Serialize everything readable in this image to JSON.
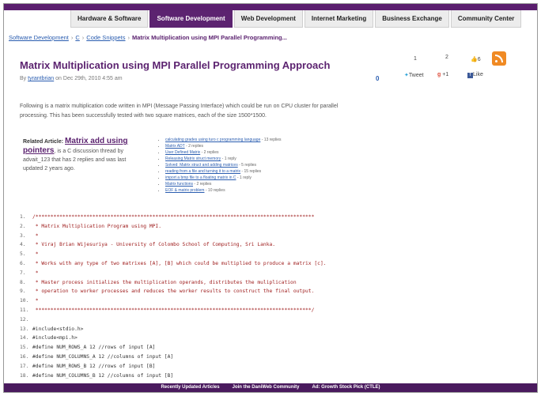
{
  "nav": {
    "tabs": [
      "Hardware & Software",
      "Software Development",
      "Web Development",
      "Internet Marketing",
      "Business Exchange",
      "Community Center"
    ],
    "active_index": 1
  },
  "breadcrumb": {
    "items": [
      "Software Development",
      "C",
      "Code Snippets"
    ],
    "current": "Matrix Multiplication using MPI Parallel Programming..."
  },
  "article": {
    "title": "Matrix Multiplication using MPI Parallel Programming Approach",
    "by_prefix": "By",
    "author": "tyrantbrian",
    "date_text": "on Dec 29th, 2010 4:55 am",
    "score": "0",
    "intro": "Following is a matrix multiplication code written in MPI (Message Passing Interface) which could be run on CPU cluster for parallel processing. This has been successfully tested with two square matrices, each of the size 1500*1500."
  },
  "social": {
    "count_1": "1",
    "count_2": "2",
    "like_count": "6",
    "tweet_label": "Tweet",
    "plus_label": "+1",
    "fb_like_label": "Like"
  },
  "related": {
    "label": "Related Article:",
    "link": "Matrix add using pointers",
    "rest": ", is a C discussion thread by advait_123 that has 2 replies and was last updated 2 years ago."
  },
  "threads": [
    {
      "title": "calculating grades using turo c programming language",
      "meta": " - 13 replies"
    },
    {
      "title": "Matrix ADT",
      "meta": " - 2 replies"
    },
    {
      "title": "User Defined Matrix",
      "meta": " - 2 replies"
    },
    {
      "title": "Releasing Matrix struct memory",
      "meta": " - 1 reply"
    },
    {
      "title": "Solved: Matrix struct and adding matrices",
      "meta": " - 5 replies"
    },
    {
      "title": "reading from a file and turning it to a matrix",
      "meta": " - 15 replies"
    },
    {
      "title": "import a bmp file to a floating matrix in C",
      "meta": " - 1 reply"
    },
    {
      "title": "Matrix functions",
      "meta": " - 2 replies"
    },
    {
      "title": "EOF & matrix problem",
      "meta": " - 10 replies"
    }
  ],
  "code": [
    {
      "n": "1.",
      "t": "/*********************************************************************************************"
    },
    {
      "n": "2.",
      "t": " * Matrix Multiplication Program using MPI."
    },
    {
      "n": "3.",
      "t": " *"
    },
    {
      "n": "4.",
      "t": " * Viraj Brian Wijesuriya - University of Colombo School of Computing, Sri Lanka."
    },
    {
      "n": "5.",
      "t": " *"
    },
    {
      "n": "6.",
      "t": " * Works with any type of two matrixes [A], [B] which could be multiplied to produce a matrix [c]."
    },
    {
      "n": "7.",
      "t": " *"
    },
    {
      "n": "8.",
      "t": " * Master process initializes the multiplication operands, distributes the muliplication"
    },
    {
      "n": "9.",
      "t": " * operation to worker processes and reduces the worker results to construct the final output."
    },
    {
      "n": "10.",
      "t": " *"
    },
    {
      "n": "11.",
      "t": " ********************************************************************************************/"
    },
    {
      "n": "12.",
      "t": ""
    },
    {
      "n": "13.",
      "t": "#include<stdio.h>"
    },
    {
      "n": "14.",
      "t": "#include<mpi.h>"
    },
    {
      "n": "15.",
      "t": "#define NUM_ROWS_A 12 //rows of input [A]"
    },
    {
      "n": "16.",
      "t": "#define NUM_COLUMNS_A 12 //columns of input [A]"
    },
    {
      "n": "17.",
      "t": "#define NUM_ROWS_B 12 //rows of input [B]"
    },
    {
      "n": "18.",
      "t": "#define NUM_COLUMNS_B 12 //columns of input [B]"
    }
  ],
  "bottombar": [
    "Recently Updated Articles",
    "Join the DaniWeb Community",
    "Ad: Growth Stock Pick (CTLE)"
  ]
}
